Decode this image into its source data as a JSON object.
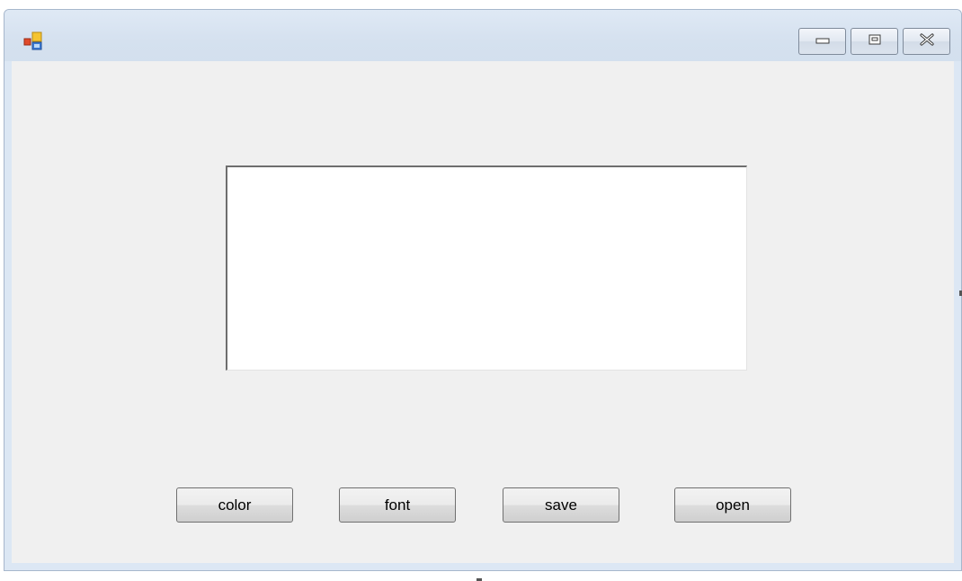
{
  "window": {
    "title": "",
    "icon": "application-window-icon",
    "caption_buttons": [
      {
        "name": "minimize",
        "icon": "minimize-icon"
      },
      {
        "name": "maximize",
        "icon": "maximize-icon"
      },
      {
        "name": "close",
        "icon": "close-icon"
      }
    ]
  },
  "editor": {
    "value": ""
  },
  "buttons": {
    "color": "color",
    "font": "font",
    "save": "save",
    "open": "open"
  },
  "colors": {
    "titlebar": "#d6e2f0",
    "client_background": "#f0f0f0",
    "textbox_background": "#ffffff"
  }
}
